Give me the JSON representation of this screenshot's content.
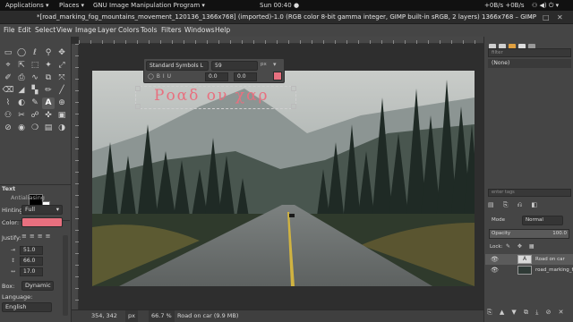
{
  "topbar": {
    "applications": "Applications ▾",
    "places": "Places ▾",
    "app_name": "GNU Image Manipulation Program ▾",
    "clock": "Sun 00:40 ●",
    "network": "+0B/s +0B/s",
    "status_icons": "⚇ ◀) ⏻ ▾"
  },
  "window": {
    "title": "*[road_marking_fog_mountains_movement_120136_1366x768] (imported)-1.0 (RGB color 8-bit gamma integer, GIMP built-in sRGB, 2 layers) 1366x768 – GIMP",
    "min": "–",
    "max": "□",
    "close": "✕"
  },
  "menu": [
    "File",
    "Edit",
    "Select",
    "View",
    "Image",
    "Layer",
    "Colors",
    "Tools",
    "Filters",
    "Windows",
    "Help"
  ],
  "tool_icons": [
    "▭",
    "◯",
    "ℓ",
    "⚲",
    "✥",
    "⌖",
    "⇱",
    "⬚",
    "✦",
    "⤢",
    "✐",
    "⎙",
    "∿",
    "⧉",
    "⤧",
    "⌫",
    "◢",
    "▚",
    "✏",
    "╱",
    "⌇",
    "◐",
    "✎",
    "A",
    "⊕",
    "⚇",
    "✂",
    "☍",
    "✜",
    "▣",
    "⊘",
    "◉",
    "❍",
    "▤",
    "◑"
  ],
  "tool_options": {
    "section": "Text",
    "antialiasing": "Antialiasing",
    "hinting_label": "Hinting:",
    "hinting_value": "Full",
    "color_label": "Color:",
    "text_color": "#e8707f",
    "justify_label": "Justify:",
    "indent": "51.0",
    "line_spacing": "66.0",
    "letter_spacing": "17.0",
    "box_label": "Box:",
    "box_value": "Dynamic",
    "language_label": "Language:",
    "language_value": "English"
  },
  "text_toolbar": {
    "font": "Standard Symbols L",
    "size": "59",
    "unit": "px",
    "baseline": "0.0",
    "kerning": "0.0",
    "color": "#e8707f"
  },
  "canvas": {
    "text_layer_content": "Ροαδ ον χαρ"
  },
  "statusbar": {
    "coords": "354, 342",
    "unit": "px",
    "zoom": "66.7 %",
    "info": "Road on car (9.9 MB)"
  },
  "right_dock": {
    "filter_placeholder": "filter",
    "none_item": "(None)",
    "tag_placeholder": "enter tags",
    "mode_label": "Mode",
    "mode_value": "Normal",
    "opacity_label": "Opacity",
    "opacity_value": "100.0",
    "lock_label": "Lock:",
    "layers": [
      {
        "name": "Road on car"
      },
      {
        "name": "road_marking_f"
      }
    ]
  }
}
